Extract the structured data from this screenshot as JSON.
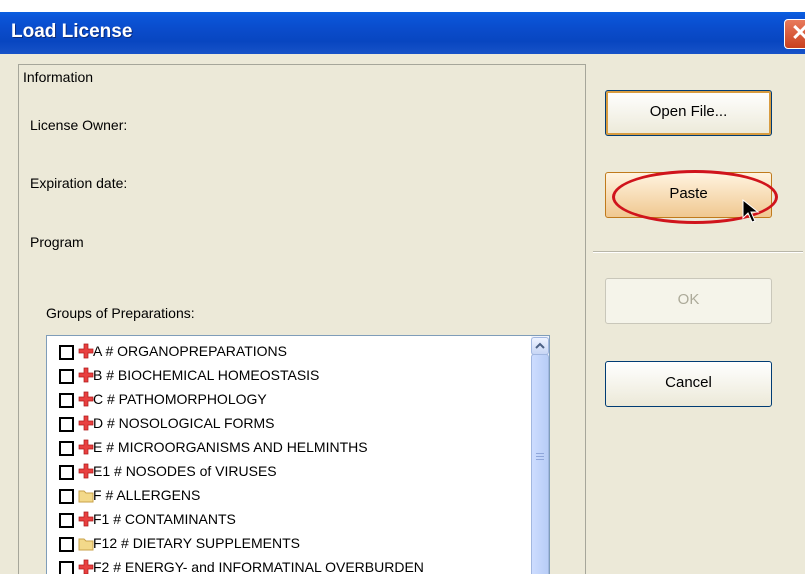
{
  "window": {
    "title": "Load License",
    "close_glyph": "✕"
  },
  "info": {
    "legend": "Information",
    "license_owner_label": "License Owner:",
    "expiration_label": "Expiration date:",
    "program_label": "Program",
    "groups_label": "Groups of Preparations:"
  },
  "groups": [
    {
      "label": "A # ORGANOPREPARATIONS",
      "checked": false,
      "icon": "red-cross-icon"
    },
    {
      "label": "B # BIOCHEMICAL HOMEOSTASIS",
      "checked": false,
      "icon": "red-cross-icon"
    },
    {
      "label": "C # PATHOMORPHOLOGY",
      "checked": false,
      "icon": "red-cross-icon"
    },
    {
      "label": "D # NOSOLOGICAL FORMS",
      "checked": false,
      "icon": "red-cross-icon"
    },
    {
      "label": "E # MICROORGANISMS AND HELMINTHS",
      "checked": false,
      "icon": "red-cross-icon"
    },
    {
      "label": "E1 # NOSODES of  VIRUSES",
      "checked": false,
      "icon": "red-cross-icon"
    },
    {
      "label": "F # ALLERGENS",
      "checked": false,
      "icon": "folder-icon"
    },
    {
      "label": "F1 # CONTAMINANTS",
      "checked": false,
      "icon": "red-cross-icon"
    },
    {
      "label": "F12 # DIETARY SUPPLEMENTS",
      "checked": false,
      "icon": "folder-icon"
    },
    {
      "label": "F2 # ENERGY- and INFORMATINAL OVERBURDEN",
      "checked": false,
      "icon": "red-cross-icon"
    }
  ],
  "buttons": {
    "open_file": "Open File...",
    "paste": "Paste",
    "ok": "OK",
    "cancel": "Cancel"
  },
  "colors": {
    "titlebar": "#0a4ccc",
    "highlight_oval": "#d0141c"
  }
}
